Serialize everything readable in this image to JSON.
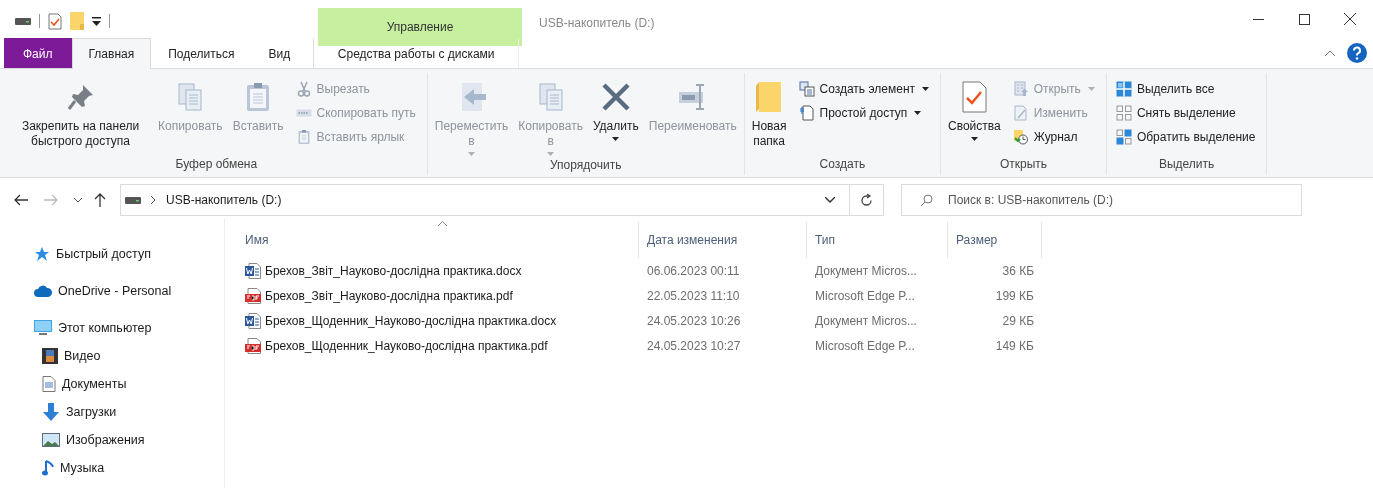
{
  "window": {
    "title": "USB-накопитель (D:)"
  },
  "tabs": [
    {
      "label": "Файл",
      "kind": "file",
      "selected": false
    },
    {
      "label": "Главная",
      "kind": "normal",
      "selected": true
    },
    {
      "label": "Поделиться",
      "kind": "normal",
      "selected": false
    },
    {
      "label": "Вид",
      "kind": "normal",
      "selected": false
    },
    {
      "label": "Средства работы с дисками",
      "kind": "context",
      "group": "Управление",
      "selected": false
    }
  ],
  "ribbon": {
    "groups": [
      {
        "label": "Буфер обмена",
        "columns": [
          {
            "kind": "large",
            "items": [
              {
                "label": "Закрепить на панели быстрого доступа",
                "disabled": false,
                "dropdown": false
              }
            ]
          },
          {
            "kind": "large",
            "items": [
              {
                "label": "Копировать",
                "disabled": true,
                "dropdown": false
              }
            ]
          },
          {
            "kind": "large",
            "items": [
              {
                "label": "Вставить",
                "disabled": true,
                "dropdown": false
              }
            ]
          },
          {
            "kind": "small",
            "items": [
              {
                "label": "Вырезать",
                "disabled": true,
                "dropdown": false
              },
              {
                "label": "Скопировать путь",
                "disabled": true,
                "dropdown": false
              },
              {
                "label": "Вставить ярлык",
                "disabled": true,
                "dropdown": false
              }
            ]
          }
        ]
      },
      {
        "label": "Упорядочить",
        "columns": [
          {
            "kind": "large",
            "items": [
              {
                "label": "Переместить в",
                "disabled": true,
                "dropdown": true
              }
            ]
          },
          {
            "kind": "large",
            "items": [
              {
                "label": "Копировать в",
                "disabled": true,
                "dropdown": true
              }
            ]
          },
          {
            "kind": "large",
            "items": [
              {
                "label": "Удалить",
                "disabled": false,
                "dropdown": true
              }
            ]
          },
          {
            "kind": "large",
            "items": [
              {
                "label": "Переименовать",
                "disabled": true,
                "dropdown": false
              }
            ]
          }
        ]
      },
      {
        "label": "Создать",
        "columns": [
          {
            "kind": "large",
            "items": [
              {
                "label": "Новая папка",
                "disabled": false,
                "dropdown": false
              }
            ]
          },
          {
            "kind": "small",
            "items": [
              {
                "label": "Создать элемент",
                "disabled": false,
                "dropdown": true
              },
              {
                "label": "Простой доступ",
                "disabled": false,
                "dropdown": true
              }
            ]
          }
        ]
      },
      {
        "label": "Открыть",
        "columns": [
          {
            "kind": "large",
            "items": [
              {
                "label": "Свойства",
                "disabled": false,
                "dropdown": true
              }
            ]
          },
          {
            "kind": "small",
            "items": [
              {
                "label": "Открыть",
                "disabled": true,
                "dropdown": true
              },
              {
                "label": "Изменить",
                "disabled": true,
                "dropdown": false
              },
              {
                "label": "Журнал",
                "disabled": false,
                "dropdown": false
              }
            ]
          }
        ]
      },
      {
        "label": "Выделить",
        "columns": [
          {
            "kind": "small",
            "items": [
              {
                "label": "Выделить все",
                "disabled": false,
                "dropdown": false
              },
              {
                "label": "Снять выделение",
                "disabled": false,
                "dropdown": false
              },
              {
                "label": "Обратить выделение",
                "disabled": false,
                "dropdown": false
              }
            ]
          }
        ]
      }
    ]
  },
  "address": {
    "path": "USB-накопитель (D:)",
    "search_placeholder": "Поиск в: USB-накопитель (D:)"
  },
  "sidebar": {
    "items": [
      {
        "label": "Быстрый доступ"
      },
      {
        "label": "OneDrive - Personal"
      },
      {
        "label": "Этот компьютер",
        "children": [
          {
            "label": "Видео"
          },
          {
            "label": "Документы"
          },
          {
            "label": "Загрузки"
          },
          {
            "label": "Изображения"
          },
          {
            "label": "Музыка"
          }
        ]
      }
    ]
  },
  "table": {
    "columns": [
      {
        "label": "Имя",
        "sorted": true
      },
      {
        "label": "Дата изменения",
        "sorted": false
      },
      {
        "label": "Тип",
        "sorted": false
      },
      {
        "label": "Размер",
        "sorted": false
      }
    ],
    "rows": [
      {
        "kind": "word",
        "name": "Брехов_Звіт_Науково-дослідна практика.docx",
        "date": "06.06.2023 00:11",
        "type": "Документ Micros...",
        "size": "36 КБ"
      },
      {
        "kind": "pdf",
        "name": "Брехов_Звіт_Науково-дослідна практика.pdf",
        "date": "22.05.2023 11:10",
        "type": "Microsoft Edge P...",
        "size": "199 КБ"
      },
      {
        "kind": "word",
        "name": "Брехов_Щоденник_Науково-дослідна практика.docx",
        "date": "24.05.2023 10:26",
        "type": "Документ Micros...",
        "size": "29 КБ"
      },
      {
        "kind": "pdf",
        "name": "Брехов_Щоденник_Науково-дослідна практика.pdf",
        "date": "24.05.2023 10:27",
        "type": "Microsoft Edge P...",
        "size": "149 КБ"
      }
    ]
  }
}
